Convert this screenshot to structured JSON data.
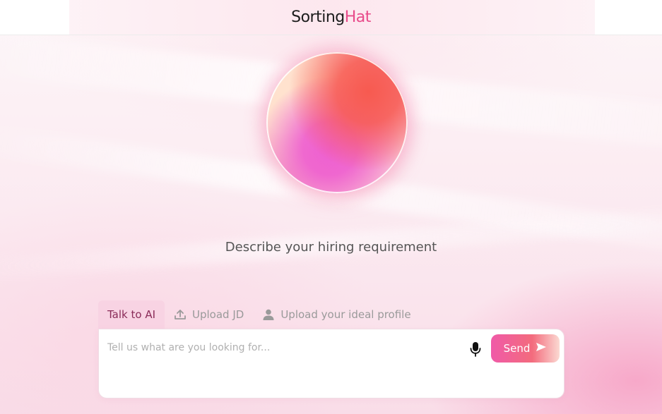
{
  "header": {
    "logo_primary": "Sorting",
    "logo_accent": "Hat"
  },
  "main": {
    "prompt": "Describe your hiring requirement"
  },
  "tabs": [
    {
      "label": "Talk to AI",
      "icon": "",
      "active": true
    },
    {
      "label": "Upload JD",
      "icon": "upload-icon",
      "active": false
    },
    {
      "label": "Upload your ideal profile",
      "icon": "user-icon",
      "active": false
    }
  ],
  "input": {
    "placeholder": "Tell us what are you looking for...",
    "value": ""
  },
  "send": {
    "label": "Send",
    "icon": "send-icon"
  },
  "colors": {
    "accent": "#e84a8a",
    "tab_active_bg": "#f8d3e3",
    "tab_active_text": "#8a2b58"
  }
}
